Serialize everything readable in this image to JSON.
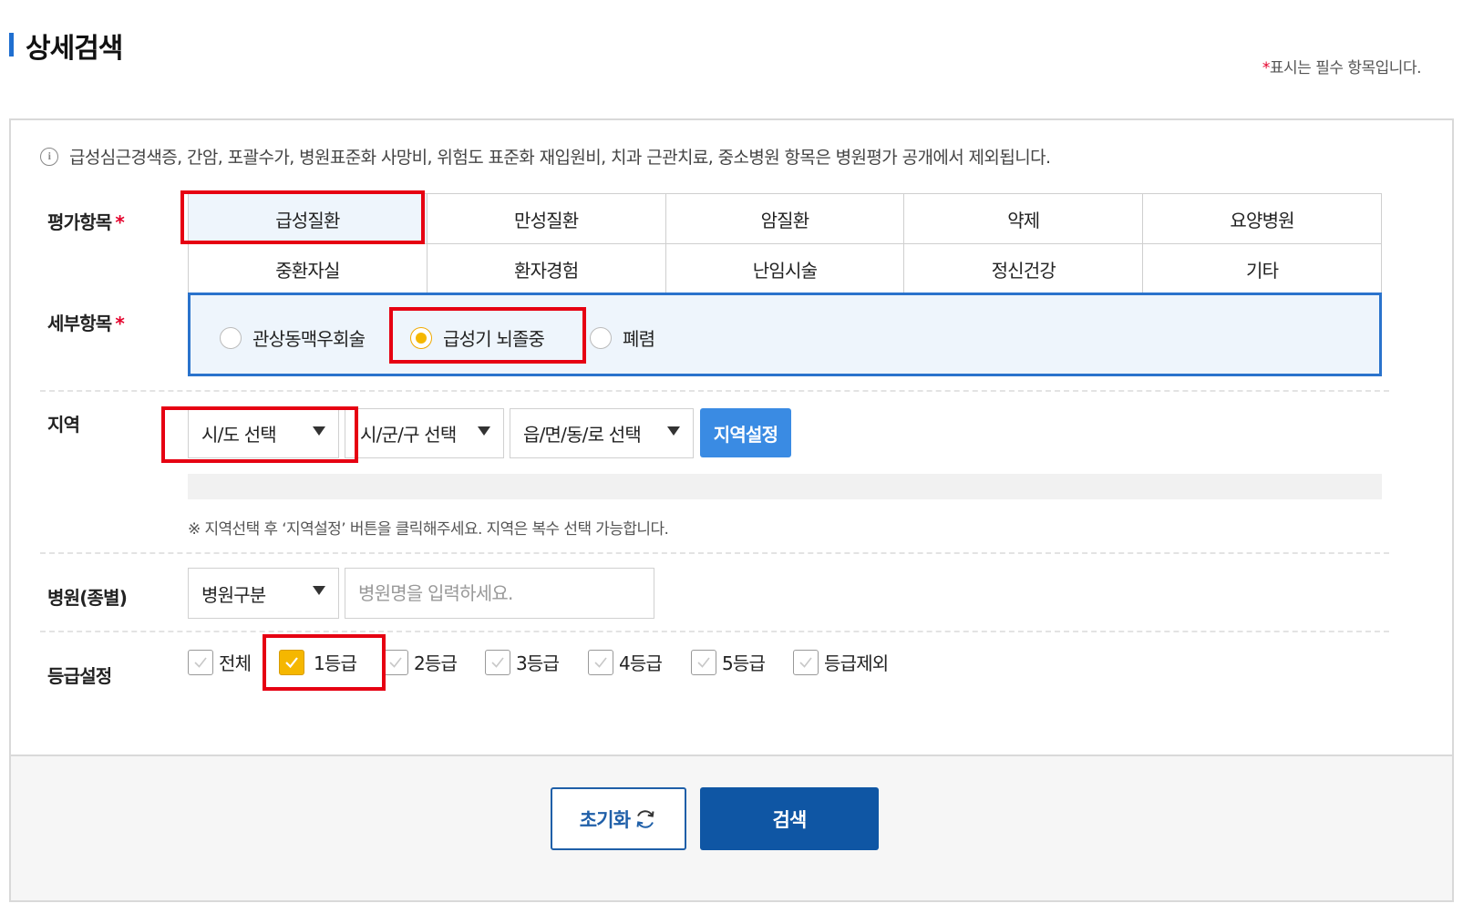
{
  "header": {
    "title": "상세검색",
    "required_star": "*",
    "required_note": "표시는 필수 항목입니다."
  },
  "notice": {
    "icon": "info-icon",
    "text": "급성심근경색증, 간암, 포괄수가, 병원표준화 사망비, 위험도 표준화 재입원비, 치과 근관치료, 중소병원 항목은 병원평가 공개에서 제외됩니다."
  },
  "evaluation": {
    "label": "평가항목",
    "star": "*",
    "tabs": [
      {
        "label": "급성질환",
        "active": true
      },
      {
        "label": "만성질환",
        "active": false
      },
      {
        "label": "암질환",
        "active": false
      },
      {
        "label": "약제",
        "active": false
      },
      {
        "label": "요양병원",
        "active": false
      },
      {
        "label": "중환자실",
        "active": false
      },
      {
        "label": "환자경험",
        "active": false
      },
      {
        "label": "난임시술",
        "active": false
      },
      {
        "label": "정신건강",
        "active": false
      },
      {
        "label": "기타",
        "active": false
      }
    ]
  },
  "detail": {
    "label": "세부항목",
    "star": "*",
    "options": [
      {
        "label": "관상동맥우회술",
        "selected": false
      },
      {
        "label": "급성기 뇌졸중",
        "selected": true
      },
      {
        "label": "폐렴",
        "selected": false
      }
    ]
  },
  "region": {
    "label": "지역",
    "sido": "시/도 선택",
    "sigungu": "시/군/구 선택",
    "eupmyeondong": "읍/면/동/로 선택",
    "set_button": "지역설정",
    "hint": "※ 지역선택 후 ‘지역설정’ 버튼을 클릭해주세요. 지역은 복수 선택 가능합니다."
  },
  "hospital": {
    "label": "병원(종별)",
    "type_select": "병원구분",
    "name_placeholder": "병원명을 입력하세요."
  },
  "grade": {
    "label": "등급설정",
    "options": [
      {
        "label": "전체",
        "checked": false
      },
      {
        "label": "1등급",
        "checked": true
      },
      {
        "label": "2등급",
        "checked": false
      },
      {
        "label": "3등급",
        "checked": false
      },
      {
        "label": "4등급",
        "checked": false
      },
      {
        "label": "5등급",
        "checked": false
      },
      {
        "label": "등급제외",
        "checked": false
      }
    ]
  },
  "actions": {
    "reset": "초기화",
    "search": "검색"
  },
  "colors": {
    "accent": "#1f6fd0",
    "selected_tab_bg": "#eef5fc",
    "checked": "#f5b700",
    "region_button": "#3a8be3",
    "search_button": "#0f56a4",
    "highlight": "#e60012",
    "required": "#e4002b"
  }
}
